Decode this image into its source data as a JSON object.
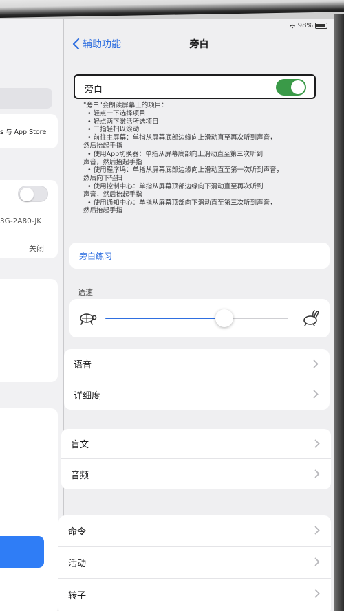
{
  "status": {
    "battery": "98%"
  },
  "nav": {
    "back_label": "辅助功能",
    "title": "旁白"
  },
  "voiceover": {
    "label": "旁白",
    "enabled": true
  },
  "description": [
    "\"旁白\"会朗读屏幕上的项目：",
    "• 轻点一下选择项目",
    "• 轻点两下激活所选项目",
    "• 三指轻扫以滚动",
    "• 前往主屏幕：单指从屏幕底部边缘向上滑动直至再次听到声音，",
    "然后抬起手指",
    "• 使用App切换器：单指从屏幕底部向上滑动直至第三次听到",
    "声音，然后抬起手指",
    "• 使用程序坞：单指从屏幕底部边缘向上滑动直至第一次听到声音，",
    "然后向下轻扫",
    "• 使用控制中心：单指从屏幕顶部边缘向下滑动直至再次听到",
    "声音，然后抬起手指",
    "• 使用通知中心：单指从屏幕顶部向下滑动直至第三次听到声音，",
    "然后抬起手指"
  ],
  "practice": {
    "label": "旁白练习"
  },
  "speech_rate": {
    "label": "语速",
    "value": 0.65
  },
  "group1": {
    "speech": "语音",
    "verbosity": "详细度"
  },
  "group2": {
    "braille": "盲文",
    "audio": "音频"
  },
  "group3": {
    "commands": "命令",
    "activities": "活动",
    "rotor": "转子"
  },
  "left_pane": {
    "store_row": "s 与 App Store",
    "device_row": "3G-2A80-JK",
    "off_value": "关闭"
  },
  "colors": {
    "accent": "#2f6fe0",
    "switch_on": "#3a9a48",
    "selected": "#2f7df6"
  }
}
